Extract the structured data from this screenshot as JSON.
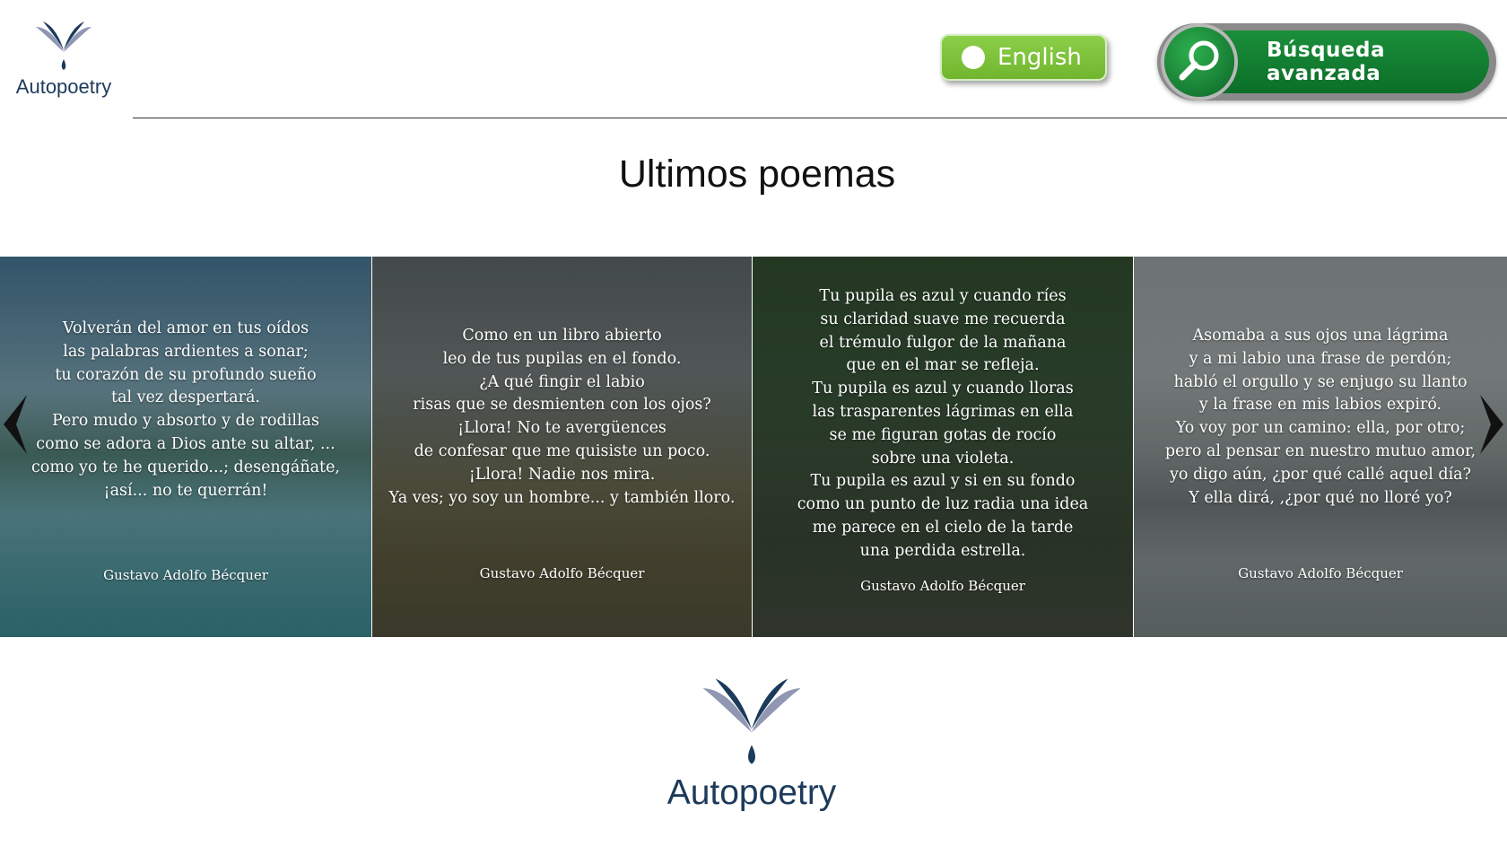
{
  "brand": {
    "name": "Autopoetry",
    "logo_icon": "book-drop-logo-icon",
    "colors": {
      "dark": "#1c3a5a",
      "light": "#8f97b3"
    }
  },
  "header": {
    "language_toggle": {
      "label": "English",
      "color": "#7ac23a"
    },
    "advanced_search": {
      "label": "Búsqueda avanzada",
      "icon": "magnifier-icon",
      "color": "#118233"
    }
  },
  "page_title": "Ultimos poemas",
  "carousel": {
    "prev_icon": "chevron-left-icon",
    "next_icon": "chevron-right-icon",
    "slides": [
      {
        "poem": "Volverán del amor en tus oídos\nlas palabras ardientes a sonar;\ntu corazón de su profundo sueño\ntal vez despertará.\nPero mudo y absorto y de rodillas\ncomo se adora a Dios ante su altar, ...\ncomo yo te he querido...; desengáñate,\n¡así... no te querrán!",
        "author": "Gustavo Adolfo Bécquer"
      },
      {
        "poem": "Como en un libro abierto\nleo de tus pupilas en el fondo.\n¿A qué fingir el labio\nrisas que se desmienten con los ojos?\n¡Llora! No te avergüences\nde confesar que me quisiste un poco.\n¡Llora! Nadie nos mira.\nYa ves; yo soy un hombre... y también lloro.",
        "author": "Gustavo Adolfo Bécquer"
      },
      {
        "poem": "Tu pupila es azul y cuando ríes\nsu claridad suave me recuerda\nel trémulo fulgor de la mañana\nque en el mar se refleja.\nTu pupila es azul y cuando lloras\nlas trasparentes lágrimas en ella\nse me figuran gotas de rocío\nsobre una violeta.\nTu pupila es azul y si en su fondo\ncomo un punto de luz radia una idea\nme parece en el cielo de la tarde\nuna perdida estrella.",
        "author": "Gustavo Adolfo Bécquer"
      },
      {
        "poem": "Asomaba a sus ojos una lágrima\ny a mi labio una frase de perdón;\nhabló el orgullo y se enjugo su llanto\ny la frase en mis labios expiró.\nYo voy por un camino: ella, por otro;\npero al pensar en nuestro mutuo amor,\nyo digo aún, ¿por qué callé aquel día?\nY ella dirá, ,¿por qué no lloré yo?",
        "author": "Gustavo Adolfo Bécquer"
      }
    ]
  }
}
